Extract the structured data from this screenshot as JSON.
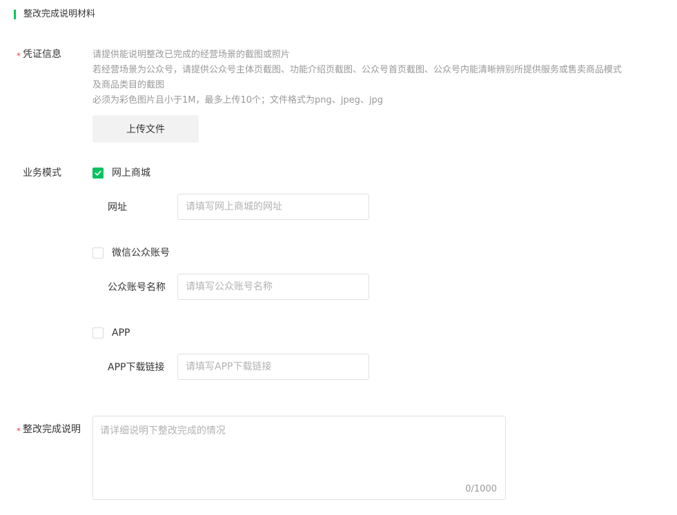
{
  "section": {
    "title": "整改完成说明材料"
  },
  "colors": {
    "accent": "#07c160",
    "required": "#e54545",
    "hint": "#999999"
  },
  "proof": {
    "required_mark": "*",
    "label": "凭证信息",
    "hints": [
      "请提供能说明整改已完成的经营场景的截图或照片",
      "若经营场景为公众号，请提供公众号主体页截图、功能介绍页截图、公众号首页截图、公众号内能清晰辨别所提供服务或售卖商品模式",
      "及商品类目的截图",
      "必须为彩色图片且小于1M，最多上传10个；文件格式为png、jpeg、jpg"
    ],
    "upload_label": "上传文件"
  },
  "business": {
    "label": "业务模式",
    "options": [
      {
        "label": "网上商城",
        "checked": true,
        "field_label": "网址",
        "placeholder": "请填写网上商城的网址"
      },
      {
        "label": "微信公众账号",
        "checked": false,
        "field_label": "公众账号名称",
        "placeholder": "请填写公众账号名称"
      },
      {
        "label": "APP",
        "checked": false,
        "field_label": "APP下载链接",
        "placeholder": "请填写APP下载链接"
      }
    ]
  },
  "description": {
    "required_mark": "*",
    "label": "整改完成说明",
    "placeholder": "请详细说明下整改完成的情况",
    "counter": "0/1000"
  }
}
